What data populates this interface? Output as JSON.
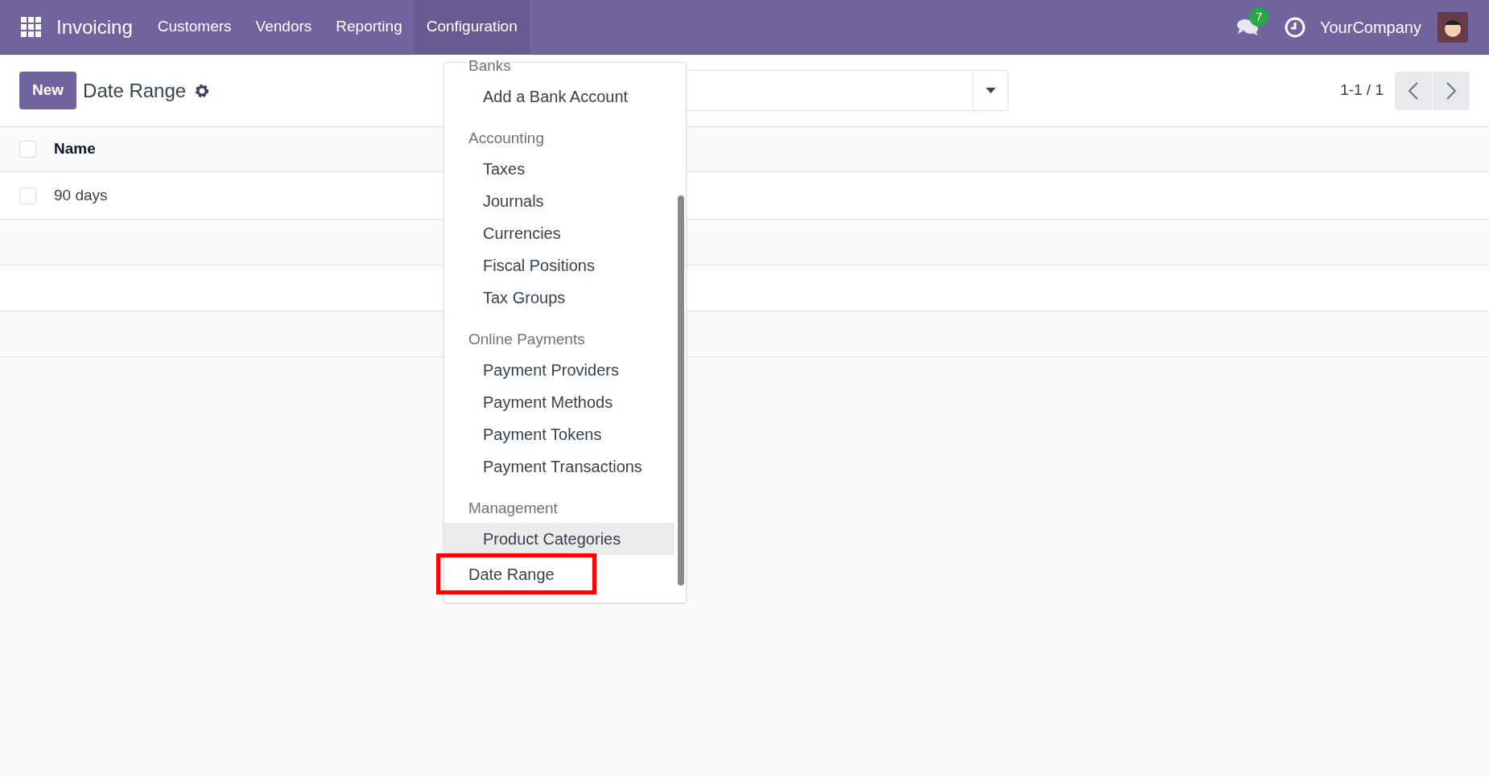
{
  "navbar": {
    "app_name": "Invoicing",
    "menu": [
      {
        "label": "Customers",
        "selected": false
      },
      {
        "label": "Vendors",
        "selected": false
      },
      {
        "label": "Reporting",
        "selected": false
      },
      {
        "label": "Configuration",
        "selected": true
      }
    ],
    "messages_badge": "7",
    "company": "YourCompany"
  },
  "control_panel": {
    "new_button": "New",
    "title": "Date Range",
    "pager": "1-1 / 1"
  },
  "table": {
    "columns": [
      "Name"
    ],
    "header_checked": false,
    "rows": [
      {
        "name": "90 days",
        "checked": false
      }
    ]
  },
  "dropdown": {
    "entries": [
      {
        "kind": "header",
        "label": "Banks"
      },
      {
        "kind": "item",
        "label": "Add a Bank Account",
        "hover": false,
        "outlined": false
      },
      {
        "kind": "header",
        "label": "Accounting"
      },
      {
        "kind": "item",
        "label": "Taxes",
        "hover": false,
        "outlined": false
      },
      {
        "kind": "item",
        "label": "Journals",
        "hover": false,
        "outlined": false
      },
      {
        "kind": "item",
        "label": "Currencies",
        "hover": false,
        "outlined": false
      },
      {
        "kind": "item",
        "label": "Fiscal Positions",
        "hover": false,
        "outlined": false
      },
      {
        "kind": "item",
        "label": "Tax Groups",
        "hover": false,
        "outlined": false
      },
      {
        "kind": "header",
        "label": "Online Payments"
      },
      {
        "kind": "item",
        "label": "Payment Providers",
        "hover": false,
        "outlined": false
      },
      {
        "kind": "item",
        "label": "Payment Methods",
        "hover": false,
        "outlined": false
      },
      {
        "kind": "item",
        "label": "Payment Tokens",
        "hover": false,
        "outlined": false
      },
      {
        "kind": "item",
        "label": "Payment Transactions",
        "hover": false,
        "outlined": false
      },
      {
        "kind": "header",
        "label": "Management"
      },
      {
        "kind": "item",
        "label": "Product Categories",
        "hover": true,
        "outlined": false
      },
      {
        "kind": "top_item",
        "label": "Date Range",
        "hover": false,
        "outlined": true
      }
    ]
  }
}
